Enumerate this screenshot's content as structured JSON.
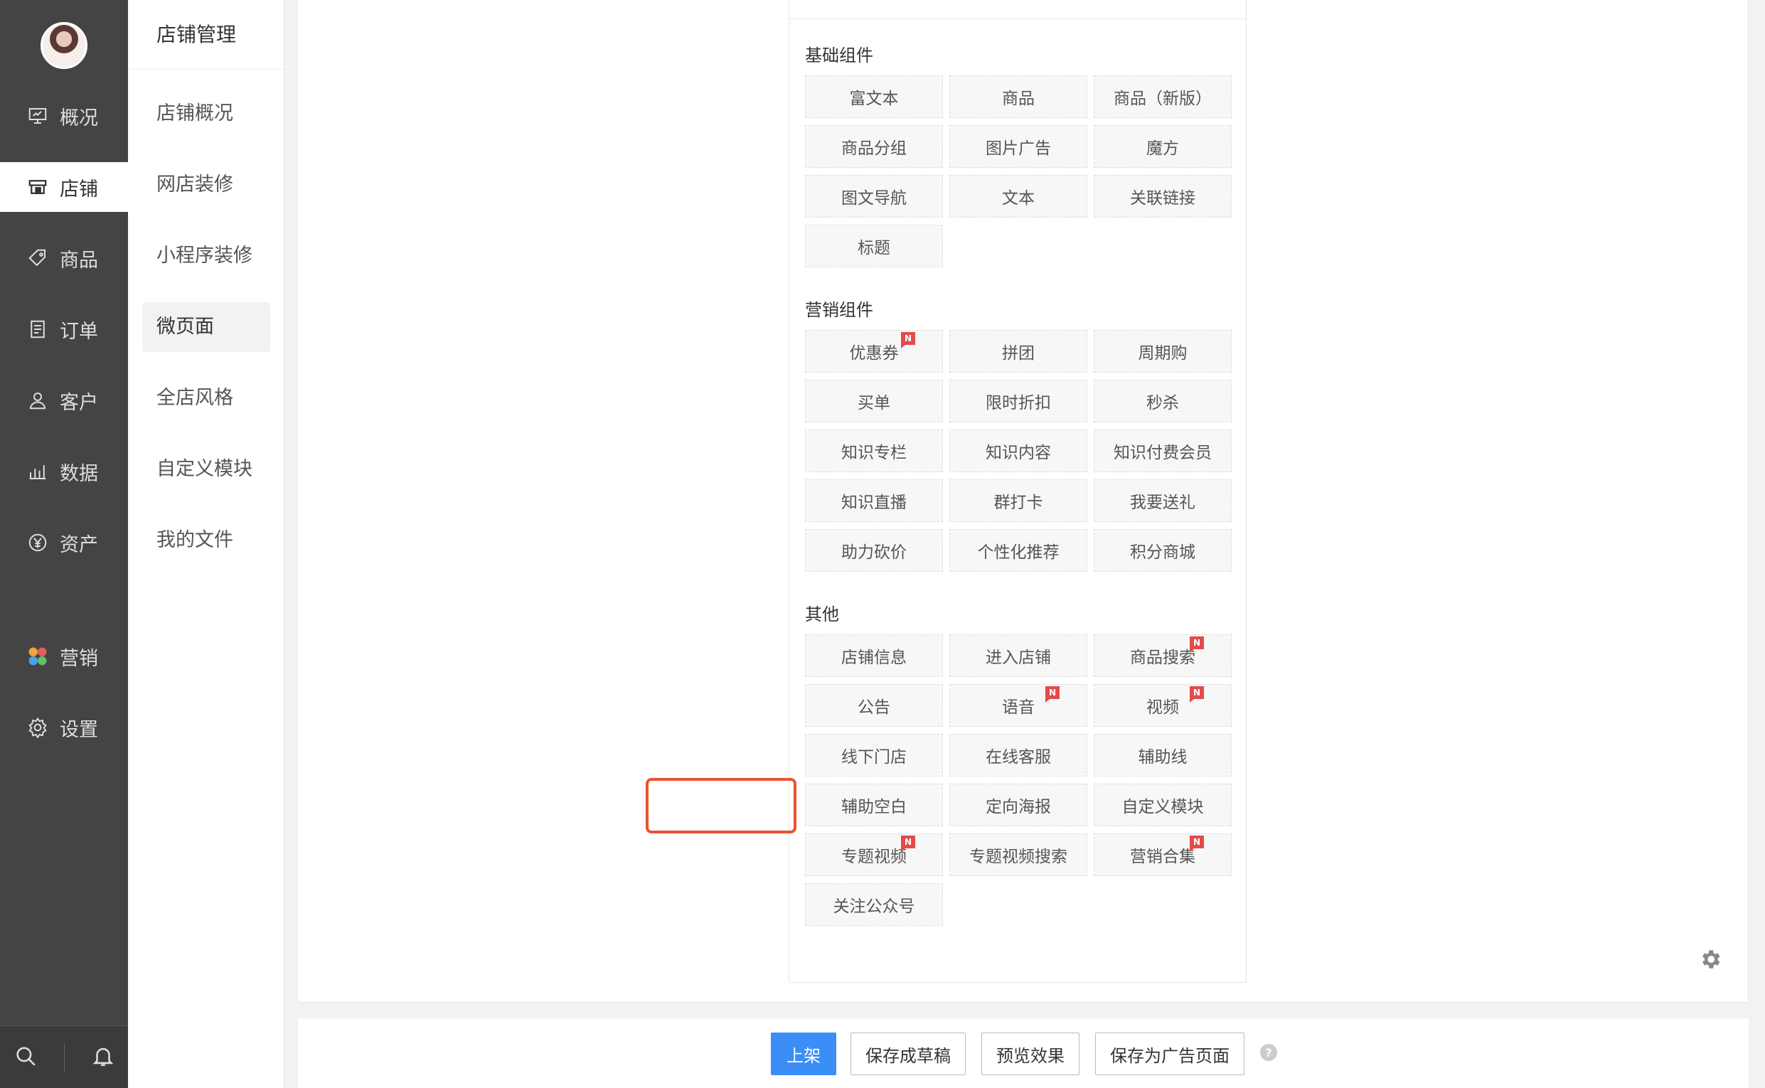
{
  "nav": {
    "items": [
      {
        "label": "概况",
        "icon": "dashboard-icon"
      },
      {
        "label": "店铺",
        "icon": "store-icon"
      },
      {
        "label": "商品",
        "icon": "tag-icon"
      },
      {
        "label": "订单",
        "icon": "order-icon"
      },
      {
        "label": "客户",
        "icon": "user-icon"
      },
      {
        "label": "数据",
        "icon": "bar-chart-icon"
      },
      {
        "label": "资产",
        "icon": "yen-icon"
      },
      {
        "label": "营销",
        "icon": "marketing-icon"
      },
      {
        "label": "设置",
        "icon": "gear-icon"
      }
    ]
  },
  "subnav": {
    "title": "店铺管理",
    "items": [
      "店铺概况",
      "网店装修",
      "小程序装修",
      "微页面",
      "全店风格",
      "自定义模块",
      "我的文件"
    ]
  },
  "panel": {
    "groups": [
      {
        "title": "基础组件",
        "items": [
          {
            "label": "富文本"
          },
          {
            "label": "商品"
          },
          {
            "label": "商品（新版）"
          },
          {
            "label": "商品分组"
          },
          {
            "label": "图片广告"
          },
          {
            "label": "魔方"
          },
          {
            "label": "图文导航"
          },
          {
            "label": "文本"
          },
          {
            "label": "关联链接"
          },
          {
            "label": "标题"
          }
        ]
      },
      {
        "title": "营销组件",
        "items": [
          {
            "label": "优惠券",
            "badge": "N"
          },
          {
            "label": "拼团"
          },
          {
            "label": "周期购"
          },
          {
            "label": "买单"
          },
          {
            "label": "限时折扣"
          },
          {
            "label": "秒杀"
          },
          {
            "label": "知识专栏"
          },
          {
            "label": "知识内容"
          },
          {
            "label": "知识付费会员"
          },
          {
            "label": "知识直播"
          },
          {
            "label": "群打卡"
          },
          {
            "label": "我要送礼"
          },
          {
            "label": "助力砍价"
          },
          {
            "label": "个性化推荐"
          },
          {
            "label": "积分商城"
          }
        ]
      },
      {
        "title": "其他",
        "items": [
          {
            "label": "店铺信息"
          },
          {
            "label": "进入店铺"
          },
          {
            "label": "商品搜索",
            "badge": "N"
          },
          {
            "label": "公告"
          },
          {
            "label": "语音",
            "badge": "N"
          },
          {
            "label": "视频",
            "badge": "N"
          },
          {
            "label": "线下门店"
          },
          {
            "label": "在线客服"
          },
          {
            "label": "辅助线"
          },
          {
            "label": "辅助空白"
          },
          {
            "label": "定向海报"
          },
          {
            "label": "自定义模块"
          },
          {
            "label": "专题视频",
            "badge": "N"
          },
          {
            "label": "专题视频搜索"
          },
          {
            "label": "营销合集",
            "badge": "N"
          },
          {
            "label": "关注公众号"
          }
        ]
      }
    ]
  },
  "actions": {
    "publish": "上架",
    "save_draft": "保存成草稿",
    "preview": "预览效果",
    "save_ad": "保存为广告页面",
    "help": "?"
  },
  "colors": {
    "nav_bg": "#444444",
    "primary": "#3a8ef6",
    "highlight": "#e8542e",
    "badge": "#e34b4b"
  }
}
